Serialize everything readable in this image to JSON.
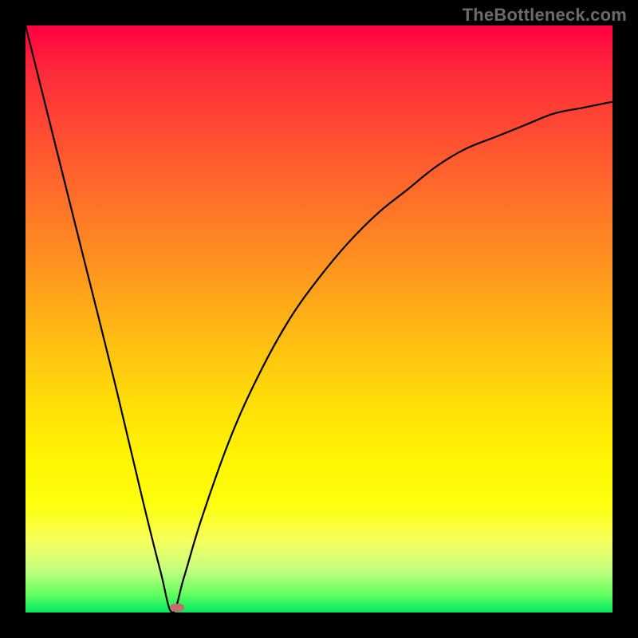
{
  "watermark": "TheBottleneck.com",
  "chart_data": {
    "type": "line",
    "title": "",
    "xlabel": "",
    "ylabel": "",
    "xlim": [
      0,
      100
    ],
    "ylim": [
      0,
      100
    ],
    "grid": false,
    "series": [
      {
        "name": "bottleneck-curve",
        "x": [
          0,
          5,
          10,
          15,
          20,
          23,
          25,
          27,
          30,
          35,
          40,
          45,
          50,
          55,
          60,
          65,
          70,
          75,
          80,
          85,
          90,
          95,
          100
        ],
        "y": [
          100,
          80,
          60,
          40,
          19,
          7,
          0,
          6,
          16,
          30,
          41,
          50,
          57,
          63,
          68,
          72,
          76,
          79,
          81,
          83,
          85,
          86,
          87
        ]
      }
    ],
    "annotations": [
      {
        "name": "optimal-point",
        "x": 25,
        "y": 0
      }
    ],
    "gradient_stops": [
      {
        "pos": 0,
        "color": "#ff0040"
      },
      {
        "pos": 50,
        "color": "#ffcc00"
      },
      {
        "pos": 85,
        "color": "#ffff40"
      },
      {
        "pos": 100,
        "color": "#00e860"
      }
    ]
  },
  "marker": {
    "left_pct": 25.8,
    "top_pct": 99.2
  }
}
